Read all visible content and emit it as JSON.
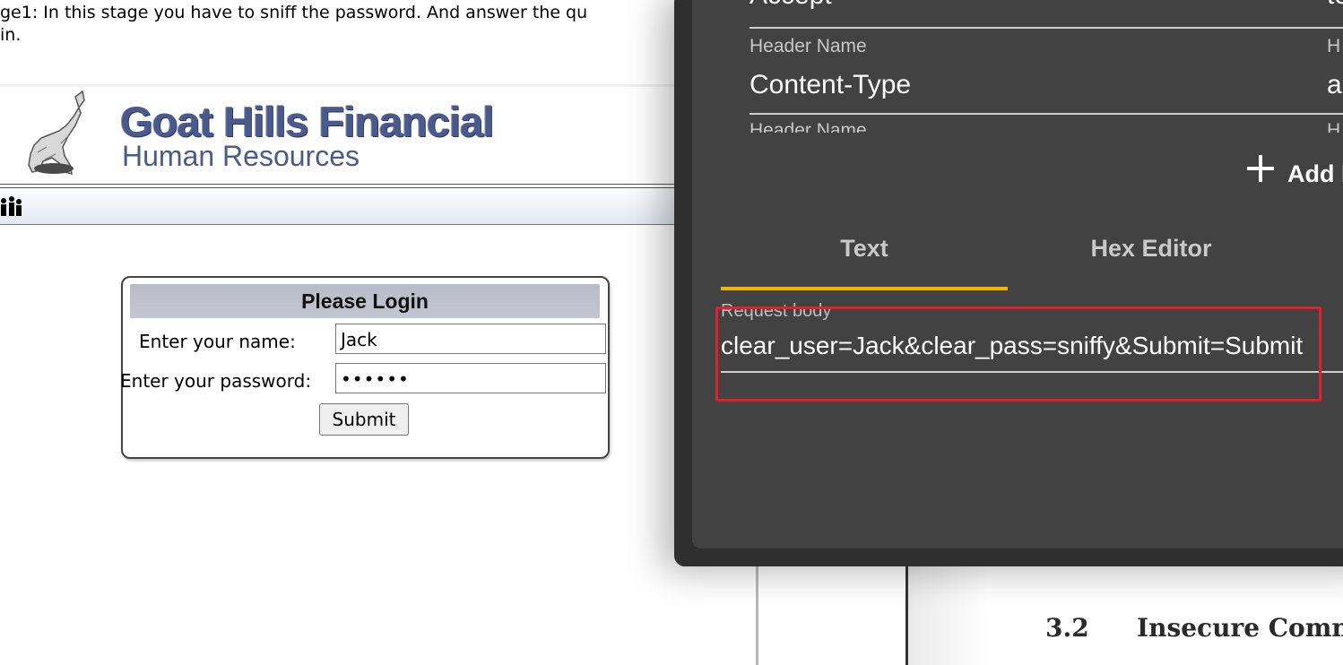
{
  "page": {
    "instructions_line1": "ge1: In this stage you have to sniff the password. And answer the qu",
    "instructions_line2": "in."
  },
  "brand": {
    "title": "Goat Hills Financial",
    "subtitle": "Human Resources"
  },
  "login": {
    "header": "Please Login",
    "name_label": "Enter your name:",
    "name_value": "Jack",
    "password_label": "Enter your password:",
    "password_value": "••••••",
    "submit_label": "Submit"
  },
  "request_editor": {
    "headers": [
      {
        "label": "",
        "value": "Accept",
        "value_right": "te"
      },
      {
        "label": "Header Name",
        "label_right": "H",
        "value": "Content-Type",
        "value_right": "a"
      },
      {
        "label": "Header Name",
        "label_right": "H"
      }
    ],
    "add_label": "Add I",
    "tabs": [
      {
        "label": "Text",
        "active": true
      },
      {
        "label": "Hex Editor",
        "active": false
      }
    ],
    "body_label": "Request body",
    "body_value": "clear_user=Jack&clear_pass=sniffy&Submit=Submit",
    "accent_color": "#f5b400",
    "highlight_color": "#e0202a"
  },
  "document": {
    "section_number": "3.2",
    "section_title": "Insecure Comm"
  }
}
